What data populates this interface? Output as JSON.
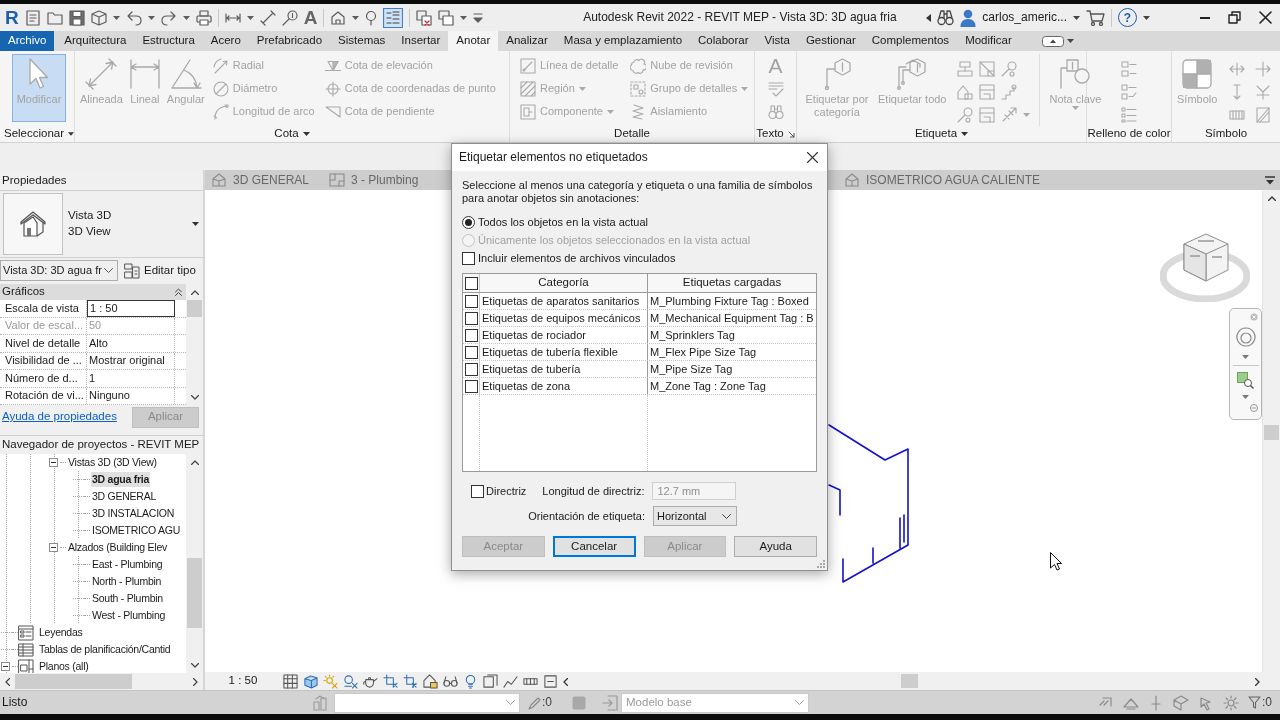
{
  "title_bar": {
    "logo": "R",
    "text_tool": "A",
    "title": "Autodesk Revit 2022 - REVIT MEP - Vista 3D: 3D agua fria",
    "user": "carlos_americ...",
    "help": "?"
  },
  "ribbon_tabs": [
    {
      "label": "Archivo",
      "kind": "file",
      "selected": false
    },
    {
      "label": "Arquitectura",
      "kind": "tab",
      "selected": false
    },
    {
      "label": "Estructura",
      "kind": "tab",
      "selected": false
    },
    {
      "label": "Acero",
      "kind": "tab",
      "selected": false
    },
    {
      "label": "Prefabricado",
      "kind": "tab",
      "selected": false
    },
    {
      "label": "Sistemas",
      "kind": "tab",
      "selected": false
    },
    {
      "label": "Insertar",
      "kind": "tab",
      "selected": false
    },
    {
      "label": "Anotar",
      "kind": "tab",
      "selected": true
    },
    {
      "label": "Analizar",
      "kind": "tab",
      "selected": false
    },
    {
      "label": "Masa y emplazamiento",
      "kind": "tab",
      "selected": false
    },
    {
      "label": "Colaborar",
      "kind": "tab",
      "selected": false
    },
    {
      "label": "Vista",
      "kind": "tab",
      "selected": false
    },
    {
      "label": "Gestionar",
      "kind": "tab",
      "selected": false
    },
    {
      "label": "Complementos",
      "kind": "tab",
      "selected": false
    },
    {
      "label": "Modificar",
      "kind": "tab",
      "selected": false
    }
  ],
  "ribbon": {
    "disabled": true,
    "panels": [
      {
        "label": "Seleccionar",
        "menu": true,
        "tools": [
          {
            "kind": "large",
            "label": "Modificar",
            "selected": true
          }
        ]
      },
      {
        "label": "Cota",
        "menu": true,
        "tools": [
          {
            "kind": "large",
            "label": "Alineada"
          },
          {
            "kind": "large",
            "label": "Lineal"
          },
          {
            "kind": "large",
            "label": "Angular"
          },
          {
            "kind": "stack",
            "items": [
              {
                "label": "Radial"
              },
              {
                "label": "Diámetro"
              },
              {
                "label": "Longitud de arco"
              }
            ]
          },
          {
            "kind": "stack",
            "items": [
              {
                "label": "Cota de elevación"
              },
              {
                "label": "Cota de coordenadas de punto"
              },
              {
                "label": "Cota de pendiente"
              }
            ]
          }
        ]
      },
      {
        "label": "Detalle",
        "tools": [
          {
            "kind": "stack",
            "items": [
              {
                "label": "Línea de detalle"
              },
              {
                "label": "Región",
                "menu": true
              },
              {
                "label": "Componente",
                "menu": true
              }
            ]
          },
          {
            "kind": "stack",
            "items": [
              {
                "label": "Nube de revisión"
              },
              {
                "label": "Grupo de detalles",
                "menu": true
              },
              {
                "label": "Aislamiento"
              }
            ]
          }
        ]
      },
      {
        "label": "Texto",
        "launcher": true,
        "tools": [
          {
            "kind": "text_stack",
            "glyph": "A"
          }
        ]
      },
      {
        "label": "Etiqueta",
        "menu": true,
        "tools": [
          {
            "kind": "large",
            "label": "Etiquetar por categoría"
          },
          {
            "kind": "large",
            "label": "Etiquetar todo"
          },
          {
            "kind": "icon_grid"
          },
          {
            "kind": "large",
            "label": "Nota clave",
            "menu": true
          }
        ]
      },
      {
        "label": "Relleno de color",
        "tools": [
          {
            "kind": "icon_grid"
          }
        ]
      },
      {
        "label": "Símbolo",
        "tools": [
          {
            "kind": "large",
            "label": "Símbolo"
          },
          {
            "kind": "icon_grid"
          }
        ]
      }
    ]
  },
  "properties": {
    "title": "Propiedades",
    "type_name": "Vista 3D",
    "type_subname": "3D View",
    "instance_selector": "Vista 3D: 3D agua fr",
    "edit_type": "Editar tipo",
    "group": "Gráficos",
    "rows": [
      {
        "label": "Escala de vista",
        "value": "1 : 50",
        "disabled": false,
        "selected": true
      },
      {
        "label": "Valor de escal...",
        "value": "50",
        "disabled": true,
        "selected": false
      },
      {
        "label": "Nivel de detalle",
        "value": "Alto",
        "disabled": false,
        "selected": false
      },
      {
        "label": "Visibilidad de ...",
        "value": "Mostrar original",
        "disabled": false,
        "selected": false
      },
      {
        "label": "Número de d...",
        "value": "1",
        "disabled": false,
        "selected": false
      },
      {
        "label": "Rotación de vi...",
        "value": "Ninguno",
        "disabled": false,
        "selected": false
      }
    ],
    "help_link": "Ayuda de propiedades",
    "apply": {
      "label": "Aplicar",
      "disabled": true
    }
  },
  "project_browser": {
    "title": "Navegador de proyectos - REVIT MEP",
    "tree": [
      {
        "children": [
          {
            "children": [
              {
                "label": "Vistas 3D (3D View)",
                "expanded": true,
                "selected": false,
                "children": [
                  {
                    "label": "3D agua fria",
                    "selected": true
                  },
                  {
                    "label": "3D GENERAL",
                    "selected": false
                  },
                  {
                    "label": "3D INSTALACION",
                    "selected": false
                  },
                  {
                    "label": "ISOMETRICO AGU",
                    "selected": false
                  }
                ]
              },
              {
                "label": "Alzados (Building Elev",
                "expanded": true,
                "selected": false,
                "children": [
                  {
                    "label": "East - Plumbing",
                    "selected": false
                  },
                  {
                    "label": "North - Plumbin",
                    "selected": false
                  },
                  {
                    "label": "South - Plumbin",
                    "selected": false
                  },
                  {
                    "label": "West - Plumbing",
                    "selected": false
                  }
                ]
              }
            ]
          }
        ]
      },
      {
        "label": "Leyendas",
        "kind": "legends",
        "selected": false
      },
      {
        "label": "Tablas de planificación/Cantid",
        "kind": "schedules",
        "selected": false
      },
      {
        "label": "Planos (all)",
        "kind": "sheets",
        "expanded": true,
        "selected": false
      }
    ]
  },
  "view_tabs": [
    {
      "label": "3D GENERAL",
      "kind": "model"
    },
    {
      "label": "3 - Plumbing",
      "kind": "plan"
    },
    {
      "label": "ISOMETRICO AGUA CALIENTE",
      "kind": "model"
    }
  ],
  "view_control_bar": {
    "scale": "1 : 50"
  },
  "status_bar": {
    "text": "Listo",
    "left_counter": ":0",
    "model": "Modelo base",
    "filter_counter": ":0"
  },
  "dialog": {
    "title": "Etiquetar elementos no etiquetados",
    "instructions": "Seleccione al menos una categoría y etiqueta o una familia de símbolos para anotar objetos sin anotaciones:",
    "scope": [
      {
        "label": "Todos los objetos en la vista actual",
        "selected": true,
        "disabled": false
      },
      {
        "label": "Únicamente los objetos seleccionados en la vista actual",
        "selected": false,
        "disabled": true
      }
    ],
    "include_linked": {
      "label": "Incluir elementos de archivos vinculados",
      "checked": false
    },
    "table": {
      "select_all_checked": false,
      "columns": [
        "Categoría",
        "Etiquetas cargadas"
      ],
      "rows": [
        {
          "checked": false,
          "category": "Etiquetas de aparatos sanitarios",
          "tag": "M_Plumbing Fixture Tag : Boxed"
        },
        {
          "checked": false,
          "category": "Etiquetas de equipos mecánicos",
          "tag": "M_Mechanical Equipment Tag : B"
        },
        {
          "checked": false,
          "category": "Etiquetas de rociador",
          "tag": "M_Sprinklers Tag"
        },
        {
          "checked": false,
          "category": "Etiquetas de tubería flexible",
          "tag": "M_Flex Pipe Size Tag"
        },
        {
          "checked": false,
          "category": "Etiquetas de tubería",
          "tag": "M_Pipe Size Tag"
        },
        {
          "checked": false,
          "category": "Etiquetas de zona",
          "tag": "M_Zone Tag : Zone Tag"
        }
      ]
    },
    "leader": {
      "label": "Directriz",
      "checked": false
    },
    "leader_length": {
      "label": "Longitud de directriz:",
      "value": "12.7 mm",
      "disabled": true
    },
    "orientation": {
      "label": "Orientación de etiqueta:",
      "value": "Horizontal"
    },
    "buttons": [
      {
        "label": "Aceptar",
        "disabled": true,
        "focused": false
      },
      {
        "label": "Cancelar",
        "disabled": false,
        "focused": true
      },
      {
        "label": "Aplicar",
        "disabled": true,
        "focused": false
      },
      {
        "label": "Ayuda",
        "disabled": false,
        "focused": false
      }
    ]
  }
}
